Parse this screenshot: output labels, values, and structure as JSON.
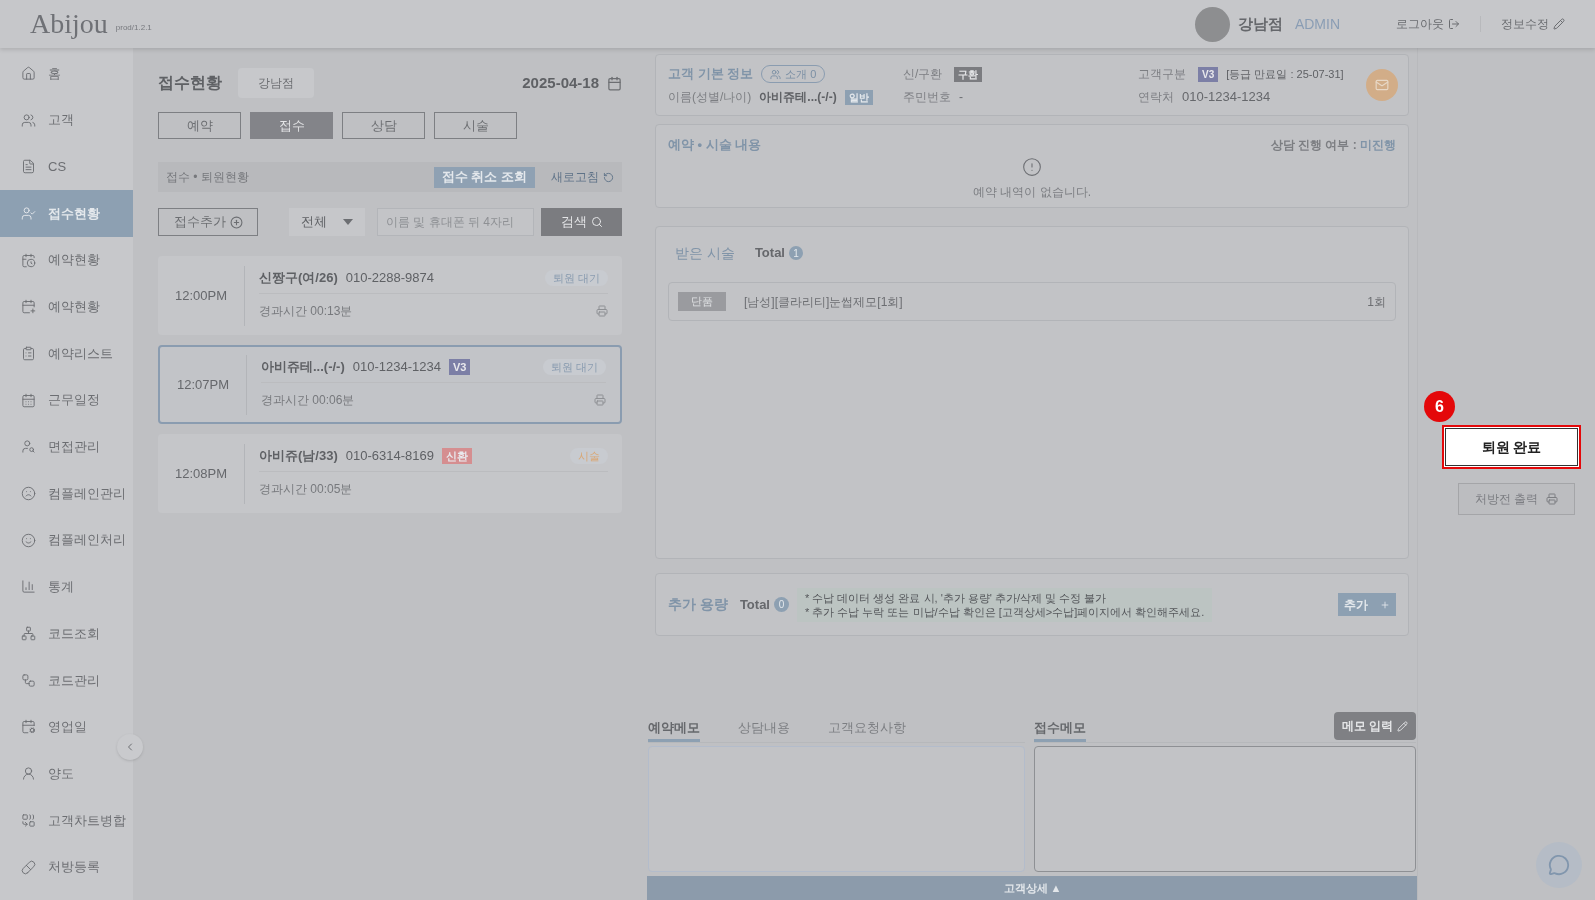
{
  "header": {
    "logo": "Abijou",
    "version": "prod/1.2.1",
    "branch": "강남점",
    "role": "ADMIN",
    "logout": "로그아웃",
    "edit_profile": "정보수정"
  },
  "sidebar": {
    "items": [
      {
        "label": "홈",
        "selected": false
      },
      {
        "label": "고객",
        "selected": false
      },
      {
        "label": "CS",
        "selected": false
      },
      {
        "label": "접수현황",
        "selected": true
      },
      {
        "label": "예약현황",
        "selected": false
      },
      {
        "label": "예약현황",
        "selected": false
      },
      {
        "label": "예약리스트",
        "selected": false
      },
      {
        "label": "근무일정",
        "selected": false
      },
      {
        "label": "면접관리",
        "selected": false
      },
      {
        "label": "컴플레인관리",
        "selected": false
      },
      {
        "label": "컴플레인처리",
        "selected": false
      },
      {
        "label": "통계",
        "selected": false
      },
      {
        "label": "코드조회",
        "selected": false
      },
      {
        "label": "코드관리",
        "selected": false
      },
      {
        "label": "영업일",
        "selected": false
      },
      {
        "label": "양도",
        "selected": false
      },
      {
        "label": "고객차트병합",
        "selected": false
      },
      {
        "label": "처방등록",
        "selected": false
      }
    ]
  },
  "reception": {
    "title": "접수현황",
    "branch": "강남점",
    "date": "2025-04-18",
    "tabs": [
      {
        "label": "예약",
        "selected": false
      },
      {
        "label": "접수",
        "selected": true
      },
      {
        "label": "상담",
        "selected": false
      },
      {
        "label": "시술",
        "selected": false
      }
    ],
    "section_title": "접수 • 퇴원현황",
    "cancel_lookup": "접수 취소 조회",
    "refresh": "새로고침",
    "add_button": "접수추가",
    "filter": "전체",
    "search_placeholder": "이름 및 휴대폰 뒤 4자리",
    "search_button": "검색",
    "entries": [
      {
        "time": "12:00PM",
        "name": "신짱구(여/26)",
        "phone": "010-2288-9874",
        "status": {
          "text": "퇴원 대기",
          "color": "#8a9cb0"
        },
        "elapsed": "경과시간 00:13분",
        "selected": false,
        "printable": true
      },
      {
        "time": "12:07PM",
        "name": "아비쥬테...(-/-)",
        "phone": "010-1234-1234",
        "badge": {
          "text": "V3",
          "color": "#7c7fa6"
        },
        "status": {
          "text": "퇴원 대기",
          "color": "#8a9cb0"
        },
        "elapsed": "경과시간 00:06분",
        "selected": true,
        "printable": true
      },
      {
        "time": "12:08PM",
        "name": "아비쥬(남/33)",
        "phone": "010-6314-8169",
        "badge": {
          "text": "신환",
          "color": "#d58e90"
        },
        "status": {
          "text": "시술",
          "color": "#d9a876"
        },
        "elapsed": "경과시간 00:05분",
        "selected": false,
        "printable": false
      }
    ]
  },
  "customer": {
    "title": "고객 기본 정보",
    "referral": "소개 0",
    "name_label": "이름(성별/나이)",
    "name": "아비쥬테...(-/-)",
    "name_badge": "일반",
    "visit_label": "신/구환",
    "visit_badge": "구환",
    "id_label": "주민번호",
    "id_value": "-",
    "grade_label": "고객구분",
    "grade_badge": "V3",
    "grade_expiry": "[등급 만료일 : 25-07-31]",
    "phone_label": "연락처",
    "phone": "010-1234-1234"
  },
  "reservation": {
    "title": "예약 • 시술 내용",
    "consult_label": "상담 진행 여부 :",
    "consult_value": "미진행",
    "empty": "예약 내역이 없습니다."
  },
  "treatments": {
    "title": "받은 시술",
    "total_label": "Total",
    "count": "1",
    "items": [
      {
        "tag": "단품",
        "name": "[남성][클라리티]눈썹제모[1회]",
        "quantity": "1회"
      }
    ]
  },
  "extra": {
    "title": "추가 용량",
    "total_label": "Total",
    "count": "0",
    "notes": [
      "* 수납 데이터 생성 완료 시, '추가 용량' 추가/삭제 및 수정 불가",
      "* 추가 수납 누락 또는 미납/수납 확인은 [고객상세>수납]페이지에서 확인해주세요."
    ],
    "add_button": "추가"
  },
  "memo": {
    "tabs": [
      {
        "label": "예약메모",
        "selected": true
      },
      {
        "label": "상담내용",
        "selected": false
      },
      {
        "label": "고객요청사항",
        "selected": false
      }
    ],
    "reception_title": "접수메모",
    "memo_button": "메모 입력",
    "footer": "고객상세 ▲"
  },
  "actions": {
    "step": "6",
    "discharge_button": "퇴원 완료",
    "prescription_button": "처방전 출력"
  }
}
